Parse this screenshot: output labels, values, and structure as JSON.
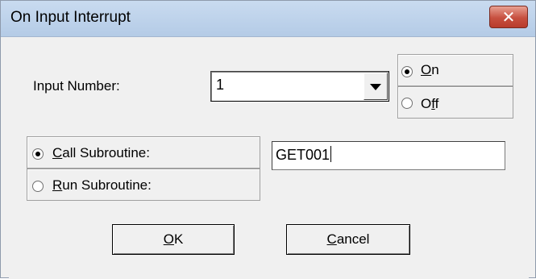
{
  "window": {
    "title": "On Input Interrupt",
    "close_glyph": "✕"
  },
  "input_number": {
    "label": "Input Number:",
    "value": "1",
    "dropdown_icon": "chevron-down-icon"
  },
  "state": {
    "options": [
      {
        "label": "On",
        "accesskey": "O",
        "rest": "n",
        "selected": true
      },
      {
        "label": "Off",
        "prefix": "O",
        "accesskey": "f",
        "rest": "f",
        "selected": false
      }
    ]
  },
  "action": {
    "options": [
      {
        "label": "Call Subroutine:",
        "accesskey": "C",
        "rest": "all Subroutine:",
        "selected": true
      },
      {
        "label": "Run Subroutine:",
        "accesskey": "R",
        "rest": "un Subroutine:",
        "selected": false
      }
    ],
    "subroutine_value": "GET001"
  },
  "buttons": {
    "ok": {
      "label": "OK",
      "accesskey": "O",
      "rest": "K"
    },
    "cancel": {
      "label": "Cancel",
      "accesskey": "C",
      "rest": "ancel"
    }
  }
}
